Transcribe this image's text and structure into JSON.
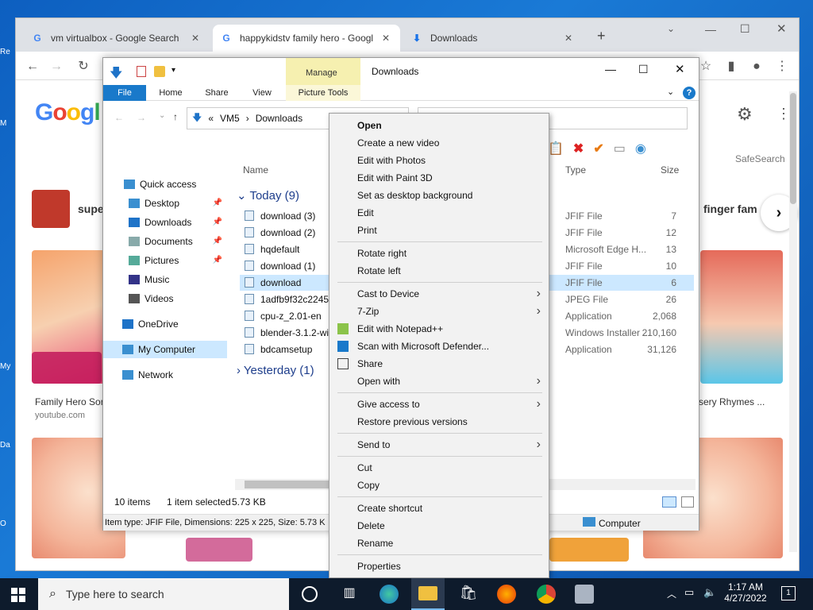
{
  "browser": {
    "tabs": [
      {
        "label": "vm virtualbox - Google Search",
        "icon": "google-icon"
      },
      {
        "label": "happykidstv family hero - Googl",
        "icon": "google-icon",
        "active": true
      },
      {
        "label": "Downloads",
        "icon": "download-icon"
      }
    ],
    "new_tab": "+",
    "page": {
      "suggestion_left": "supe",
      "suggestion_right": "finger fam",
      "card_left_title": "Family Hero Sor",
      "card_left_source": "youtube.com",
      "card_right_title": "sery Rhymes ...",
      "safesearch": "SafeSearch"
    }
  },
  "desktop_labels": [
    "Re",
    "M",
    "My",
    "Da",
    "O"
  ],
  "explorer": {
    "title": "Downloads",
    "manage_tab": "Manage",
    "ribbon_tabs": [
      "File",
      "Home",
      "Share",
      "View",
      "Picture Tools"
    ],
    "breadcrumb": [
      "«",
      "VM5",
      "›",
      "Downloads"
    ],
    "nav": [
      {
        "label": "Quick access",
        "icon": "star-icon"
      },
      {
        "label": "Desktop",
        "icon": "desktop-icon",
        "pinned": true
      },
      {
        "label": "Downloads",
        "icon": "download-icon",
        "pinned": true
      },
      {
        "label": "Documents",
        "icon": "document-icon",
        "pinned": true
      },
      {
        "label": "Pictures",
        "icon": "picture-icon",
        "pinned": true
      },
      {
        "label": "Music",
        "icon": "music-icon"
      },
      {
        "label": "Videos",
        "icon": "video-icon"
      },
      {
        "label": "OneDrive",
        "icon": "cloud-icon"
      },
      {
        "label": "My Computer",
        "icon": "computer-icon",
        "selected": true
      },
      {
        "label": "Network",
        "icon": "network-icon"
      }
    ],
    "columns": {
      "name": "Name",
      "type": "Type",
      "size": "Size"
    },
    "groups": {
      "today": "Today (9)",
      "yesterday": "Yesterday (1)"
    },
    "files": [
      {
        "name": "download (3)",
        "type": "JFIF File",
        "size": "7"
      },
      {
        "name": "download (2)",
        "type": "JFIF File",
        "size": "12"
      },
      {
        "name": "hqdefault",
        "type": "Microsoft Edge H...",
        "size": "13"
      },
      {
        "name": "download (1)",
        "type": "JFIF File",
        "size": "10"
      },
      {
        "name": "download",
        "type": "JFIF File",
        "size": "6",
        "selected": true
      },
      {
        "name": "1adfb9f32c22458",
        "type": "JPEG File",
        "size": "26"
      },
      {
        "name": "cpu-z_2.01-en",
        "type": "Application",
        "size": "2,068"
      },
      {
        "name": "blender-3.1.2-wi",
        "type": "Windows Installer ...",
        "size": "210,160"
      },
      {
        "name": "bdcamsetup",
        "type": "Application",
        "size": "31,126"
      }
    ],
    "status": {
      "count": "10 items",
      "selected": "1 item selected",
      "size": "5.73 KB"
    },
    "details_bar": "Item type: JFIF File, Dimensions: 225 x 225, Size: 5.73 K",
    "computer_label": "Computer"
  },
  "context_menu": [
    {
      "label": "Open",
      "bold": true
    },
    {
      "label": "Create a new video"
    },
    {
      "label": "Edit with Photos"
    },
    {
      "label": "Edit with Paint 3D"
    },
    {
      "label": "Set as desktop background"
    },
    {
      "label": "Edit"
    },
    {
      "label": "Print"
    },
    {
      "sep": true
    },
    {
      "label": "Rotate right"
    },
    {
      "label": "Rotate left"
    },
    {
      "sep": true
    },
    {
      "label": "Cast to Device",
      "sub": true
    },
    {
      "label": "7-Zip",
      "sub": true
    },
    {
      "label": "Edit with Notepad++",
      "icon": "notepad-icon"
    },
    {
      "label": "Scan with Microsoft Defender...",
      "icon": "defender-icon"
    },
    {
      "label": "Share",
      "icon": "share-icon"
    },
    {
      "label": "Open with",
      "sub": true
    },
    {
      "sep": true
    },
    {
      "label": "Give access to",
      "sub": true
    },
    {
      "label": "Restore previous versions"
    },
    {
      "sep": true
    },
    {
      "label": "Send to",
      "sub": true
    },
    {
      "sep": true
    },
    {
      "label": "Cut"
    },
    {
      "label": "Copy"
    },
    {
      "sep": true
    },
    {
      "label": "Create shortcut"
    },
    {
      "label": "Delete"
    },
    {
      "label": "Rename"
    },
    {
      "sep": true
    },
    {
      "label": "Properties"
    }
  ],
  "taskbar": {
    "search_placeholder": "Type here to search",
    "time": "1:17 AM",
    "date": "4/27/2022",
    "notification_count": "1"
  },
  "colors": {
    "accent": "#0063b1",
    "selected": "#cce8ff",
    "taskbar": "#0e1b2c"
  }
}
